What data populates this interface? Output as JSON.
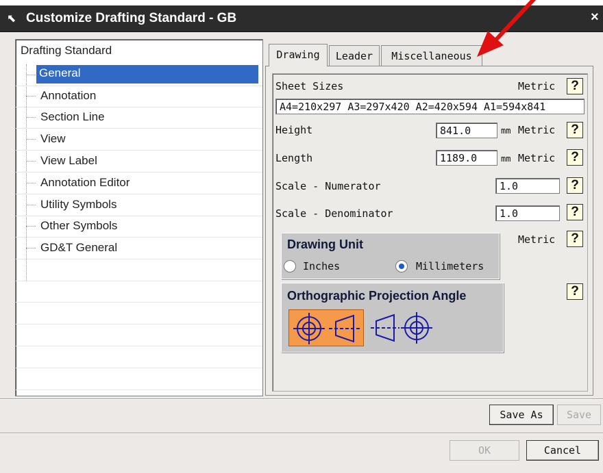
{
  "window": {
    "title": "Customize Drafting Standard - GB",
    "close_glyph": "×"
  },
  "tree": {
    "root": "Drafting Standard",
    "items": [
      {
        "label": "General",
        "selected": true
      },
      {
        "label": "Annotation"
      },
      {
        "label": "Section Line"
      },
      {
        "label": "View"
      },
      {
        "label": "View Label"
      },
      {
        "label": "Annotation Editor"
      },
      {
        "label": "Utility Symbols"
      },
      {
        "label": "Other Symbols"
      },
      {
        "label": "GD&T General"
      }
    ]
  },
  "tabs": [
    {
      "label": "Drawing",
      "active": true
    },
    {
      "label": "Leader"
    },
    {
      "label": "Miscellaneous"
    }
  ],
  "drawing": {
    "sheet_sizes_label": "Sheet Sizes",
    "sheet_sizes_unit": "Metric",
    "sheet_sizes_value": "A4=210x297 A3=297x420 A2=420x594 A1=594x841",
    "height_label": "Height",
    "height_value": "841.0",
    "height_unit": "mm",
    "height_unit_system": "Metric",
    "length_label": "Length",
    "length_value": "1189.0",
    "length_unit": "mm",
    "length_unit_system": "Metric",
    "scale_num_label": "Scale - Numerator",
    "scale_num_value": "1.0",
    "scale_den_label": "Scale - Denominator",
    "scale_den_value": "1.0",
    "unit_title": "Drawing Unit",
    "unit_metric": "Metric",
    "unit_inches": "Inches",
    "unit_millimeters": "Millimeters",
    "unit_selected": "Millimeters",
    "projection_title": "Orthographic Projection Angle",
    "projection_selected": "first-angle",
    "help_glyph": "?"
  },
  "buttons": {
    "save_as": "Save As",
    "save": "Save",
    "ok": "OK",
    "cancel": "Cancel"
  },
  "icons": [
    "arrow-cursor-icon",
    "help-icon",
    "first-angle-projection-icon",
    "third-angle-projection-icon",
    "red-arrow-annotation"
  ],
  "colors": {
    "titlebar": "#2c2c2c",
    "selection": "#316ac5",
    "projection_selected_bg": "#f59a4a",
    "annotation_arrow": "#e01010",
    "projection_symbol": "#1a1aa8"
  }
}
